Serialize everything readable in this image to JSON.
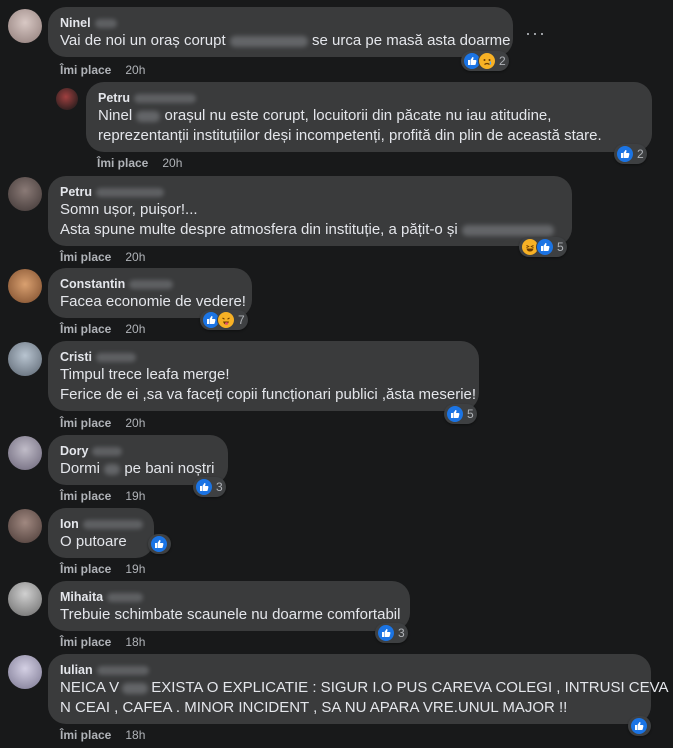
{
  "like_label": "Îmi place",
  "colors": {
    "background": "#18191a",
    "bubble": "#3a3b3c",
    "like_blue": "#1b74e4",
    "emoji_yellow": "#f7b125"
  },
  "more_icon": "more-options-icon",
  "comments": [
    {
      "author": "Ninel",
      "lines": [
        "Vai de noi un oraș corupt",
        "se urca pe masă asta doarme"
      ],
      "time": "20h",
      "reactions": [
        "like",
        "sad"
      ],
      "count": "2"
    },
    {
      "author": "Petru",
      "lines": [
        "Ninel",
        "orașul nu este corupt, locuitorii din păcate nu iau atitudine,",
        "reprezentanții instituțiilor deși incompetenți, profită din plin de această stare."
      ],
      "time": "20h",
      "reactions": [
        "like"
      ],
      "count": "2"
    },
    {
      "author": "Petru",
      "lines": [
        "Somn ușor, puișor!...",
        "Asta spune multe despre atmosfera din instituție, a pățit-o și"
      ],
      "time": "20h",
      "reactions": [
        "haha",
        "like"
      ],
      "count": "5"
    },
    {
      "author": "Constantin",
      "lines": [
        "Facea economie de vedere!"
      ],
      "time": "20h",
      "reactions": [
        "like",
        "tongue"
      ],
      "count": "7"
    },
    {
      "author": "Cristi",
      "lines": [
        "Timpul trece leafa merge!",
        "Ferice de ei ,sa va faceți copii funcționari publici ,ăsta meserie!"
      ],
      "time": "20h",
      "reactions": [
        "like"
      ],
      "count": "5"
    },
    {
      "author": "Dory",
      "lines": [
        "Dormi",
        "pe bani noștri"
      ],
      "time": "19h",
      "reactions": [
        "like"
      ],
      "count": "3"
    },
    {
      "author": "Ion",
      "lines": [
        "O putoare"
      ],
      "time": "19h",
      "reactions": [
        "like"
      ],
      "count": ""
    },
    {
      "author": "Mihaita",
      "lines": [
        "Trebuie schimbate scaunele nu doarme comfortabil"
      ],
      "time": "18h",
      "reactions": [
        "like"
      ],
      "count": "3"
    },
    {
      "author": "Iulian",
      "lines": [
        "NEICA V",
        "EXISTA O EXPLICATIE : SIGUR I.O PUS CAREVA COLEGI , INTRUSI CEVA .",
        "N CEAI , CAFEA . MINOR INCIDENT , SA NU APARA VRE.UNUL MAJOR !!"
      ],
      "time": "18h",
      "reactions": [
        "like"
      ],
      "count": ""
    }
  ]
}
